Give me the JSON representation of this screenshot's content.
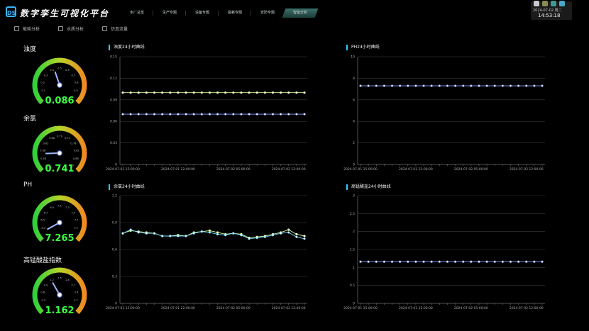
{
  "app": {
    "logo_text": "DS",
    "title": "数字孪生可视化平台"
  },
  "nav": {
    "tabs": [
      {
        "label": "水厂总览",
        "active": false
      },
      {
        "label": "生产专题",
        "active": false
      },
      {
        "label": "设备专题",
        "active": false
      },
      {
        "label": "能耗专题",
        "active": false
      },
      {
        "label": "安防专题",
        "active": false
      },
      {
        "label": "智能分析",
        "active": true
      }
    ]
  },
  "status": {
    "date": "2024-07-02",
    "weekday": "周二",
    "time": "14:53:18",
    "icon_colors": [
      "#c9c9c9",
      "#8a8a55",
      "#3a9c8f",
      "#4aa7c9"
    ]
  },
  "subnav": {
    "items": [
      {
        "label": "能耗分析",
        "icon": "gauge-icon"
      },
      {
        "label": "水质分析",
        "icon": "water-icon"
      },
      {
        "label": "仿真流量",
        "icon": "flow-icon"
      }
    ]
  },
  "colors": {
    "accent": "#2ec9ff",
    "gauge_value": "#39ff42",
    "series_green": "#d9ff9c",
    "series_blue": "#8aa2ff",
    "series_cyan": "#6fd6ff"
  },
  "gauges": [
    {
      "label": "浊度",
      "value": "0.086",
      "fraction": 0.43,
      "ticks": [
        "0",
        "0.1",
        "0.2",
        "0.3",
        "0.4",
        "0.5",
        "0.6",
        "0.7",
        "0.8",
        "0.9",
        "1"
      ]
    },
    {
      "label": "余氯",
      "value": "0.741",
      "fraction": 0.16,
      "ticks": [
        "0.5",
        "0.54",
        "0.58",
        "0.62",
        "0.66",
        "0.70",
        "0.74",
        "0.78",
        "0.82",
        "0.86",
        "0.9"
      ]
    },
    {
      "label": "PH",
      "value": "7.265",
      "fraction": 0.06,
      "ticks": [
        "6",
        "6.3",
        "6.5",
        "6.7",
        "6.9",
        "7.1",
        "7.3",
        "7.5",
        "7.7",
        "7.9",
        "8"
      ]
    },
    {
      "label": "高锰酸盐指数",
      "value": "1.162",
      "fraction": 0.39,
      "ticks": [
        "0",
        "0.3",
        "0.6",
        "0.9",
        "1.2",
        "1.5",
        "1.8",
        "2.1",
        "2.4",
        "2.7",
        "3"
      ]
    }
  ],
  "chart_data": [
    {
      "type": "line",
      "title": "浊度24小时曲线",
      "ylim": [
        0,
        0.15
      ],
      "yticks": [
        "0",
        "0.03",
        "0.06",
        "0.09",
        "0.12",
        "0.15"
      ],
      "xticks": [
        "2024-07-01 15:00:00",
        "2024-07-01 22:00:00",
        "2024-07-02 05:00:00",
        "2024-07-02 12:00:00"
      ],
      "grid": true,
      "series": [
        {
          "color": "#d9ff9c",
          "values": [
            0.1,
            0.1,
            0.1,
            0.1,
            0.1,
            0.1,
            0.1,
            0.1,
            0.1,
            0.1,
            0.1,
            0.1,
            0.1,
            0.1,
            0.1,
            0.1,
            0.1,
            0.1,
            0.1,
            0.1,
            0.1,
            0.1,
            0.1,
            0.1
          ]
        },
        {
          "color": "#8aa2ff",
          "values": [
            0.07,
            0.07,
            0.07,
            0.07,
            0.07,
            0.07,
            0.07,
            0.07,
            0.07,
            0.07,
            0.07,
            0.07,
            0.07,
            0.07,
            0.07,
            0.07,
            0.07,
            0.07,
            0.07,
            0.07,
            0.07,
            0.07,
            0.07,
            0.07
          ]
        }
      ]
    },
    {
      "type": "line",
      "title": "PH24小时曲线",
      "ylim": [
        0,
        10
      ],
      "yticks": [
        "0",
        "2",
        "4",
        "6",
        "8",
        "10"
      ],
      "xticks": [
        "2024-07-01 15:00:00",
        "2024-07-01 22:00:00",
        "2024-07-02 05:00:00",
        "2024-07-02 12:00:00"
      ],
      "grid": true,
      "series": [
        {
          "color": "#8aa2ff",
          "values": [
            7.3,
            7.3,
            7.3,
            7.3,
            7.3,
            7.3,
            7.3,
            7.3,
            7.3,
            7.3,
            7.3,
            7.3,
            7.3,
            7.3,
            7.3,
            7.3,
            7.3,
            7.3,
            7.3,
            7.3,
            7.3,
            7.3,
            7.3,
            7.3
          ]
        }
      ]
    },
    {
      "type": "line",
      "title": "余氯24小时曲线",
      "ylim": [
        0,
        1.2
      ],
      "yticks": [
        "0",
        "0.3",
        "0.6",
        "0.9",
        "1.2"
      ],
      "xticks": [
        "2024-07-01 15:00:00",
        "2024-07-01 22:00:00",
        "2024-07-02 05:00:00",
        "2024-07-02 12:00:00"
      ],
      "grid": true,
      "series": [
        {
          "color": "#d9ff9c",
          "values": [
            0.78,
            0.81,
            0.8,
            0.79,
            0.78,
            0.75,
            0.75,
            0.76,
            0.75,
            0.79,
            0.8,
            0.81,
            0.79,
            0.77,
            0.78,
            0.77,
            0.73,
            0.74,
            0.75,
            0.77,
            0.79,
            0.82,
            0.77,
            0.75
          ]
        },
        {
          "color": "#6fd6ff",
          "values": [
            0.78,
            0.82,
            0.79,
            0.78,
            0.78,
            0.75,
            0.75,
            0.75,
            0.75,
            0.78,
            0.8,
            0.79,
            0.77,
            0.76,
            0.78,
            0.76,
            0.72,
            0.73,
            0.74,
            0.76,
            0.78,
            0.79,
            0.74,
            0.72
          ]
        }
      ]
    },
    {
      "type": "line",
      "title": "高锰酸盐24小时曲线",
      "ylim": [
        0,
        3
      ],
      "yticks": [
        "0",
        "0.5",
        "1",
        "1.5",
        "2",
        "2.5",
        "3"
      ],
      "xticks": [
        "2024-07-01 15:00:00",
        "2024-07-01 22:00:00",
        "2024-07-02 05:00:00",
        "2024-07-02 12:00:00"
      ],
      "grid": true,
      "series": [
        {
          "color": "#8aa2ff",
          "values": [
            1.16,
            1.16,
            1.16,
            1.16,
            1.16,
            1.16,
            1.16,
            1.16,
            1.16,
            1.16,
            1.16,
            1.16,
            1.16,
            1.16,
            1.16,
            1.16,
            1.16,
            1.16,
            1.16,
            1.16,
            1.16,
            1.16,
            1.16,
            1.16
          ]
        }
      ]
    }
  ]
}
